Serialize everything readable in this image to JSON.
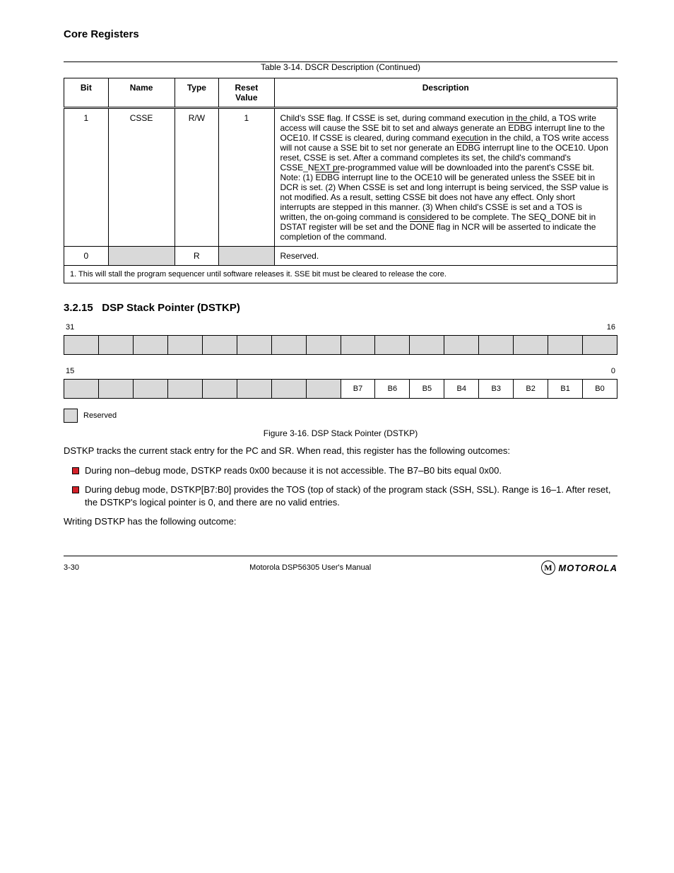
{
  "header": {
    "title": "Core Registers"
  },
  "table14": {
    "caption": "Table 3-14.   DSCR Description  (Continued)",
    "cols": [
      "Bit",
      "Name",
      "Type",
      "Reset Value",
      "Description"
    ],
    "rows": [
      {
        "bit": "1",
        "name": "CSSE",
        "type": "R/W",
        "reset": "1",
        "desc_html": "Child's SSE flag. If CSSE is set, during command execution in the child, a TOS write access will cause the SSE bit to set and always generate an <span class=\"ov\">EDBG</span> interrupt line to the OCE10. If CSSE is cleared, during command execution in the child, a TOS write access will not cause a SSE bit to set nor generate an <span class=\"ov\">EDBG</span> interrupt line to the OCE10. Upon reset, CSSE is set. After a command completes its set, the child's command's CSSE_NEXT pre-programmed value will be downloaded into the parent's CSSE bit.<br>Note: (1) <span class=\"ov\">EDBG</span> interrupt line to the OCE10 will be generated unless the SSEE bit in DCR is set. (2) When CSSE is set and long interrupt is being serviced, the SSP value is not modified. As a result, setting CSSE bit does not have any effect. Only short interrupts are stepped in this manner. (3) When child's CSSE is set and a TOS is written, the on-going command is considered to be complete. The SEQ_DONE bit in DSTAT register will be set and the <span class=\"ov\">DONE</span> flag in NCR will be asserted to indicate the completion of the command."
      },
      {
        "bit": "0",
        "name": "",
        "type": "R",
        "reset": "",
        "desc": "Reserved."
      }
    ],
    "footnote": "1.   This will stall the program sequencer until software releases it. SSE bit must be cleared to release the core."
  },
  "subsec": {
    "num": "3.2.15",
    "title": "DSP Stack Pointer (DSTKP)"
  },
  "bitrow1": {
    "start": 31,
    "end": 16
  },
  "bitrow2": {
    "start": 15,
    "end": 0,
    "labels": {
      "7": "B7",
      "6": "B6",
      "5": "B5",
      "4": "B4",
      "3": "B3",
      "2": "B2",
      "1": "B1",
      "0": "B0"
    }
  },
  "figure": {
    "caption": "Figure 3-16.   DSP Stack Pointer (DSTKP)"
  },
  "legend": "Reserved",
  "para1": "DSTKP tracks the current stack entry for the PC and SR. When read, this register has the following outcomes:",
  "bullets": [
    "During non–debug mode, DSTKP reads 0x00 because it is not accessible. The B7–B0 bits equal 0x00.",
    "During debug mode, DSTKP[B7:B0] provides the TOS (top of stack) of the program stack (SSH, SSL). Range is 16–1. After reset, the DSTKP's logical pointer is 0, and there are no valid entries."
  ],
  "para2": "Writing DSTKP has the following outcome:",
  "footer": {
    "pg": "3-30",
    "doc": "Motorola DSP56305 User's Manual"
  },
  "logo": {
    "glyph": "M",
    "word": "MOTOROLA"
  }
}
